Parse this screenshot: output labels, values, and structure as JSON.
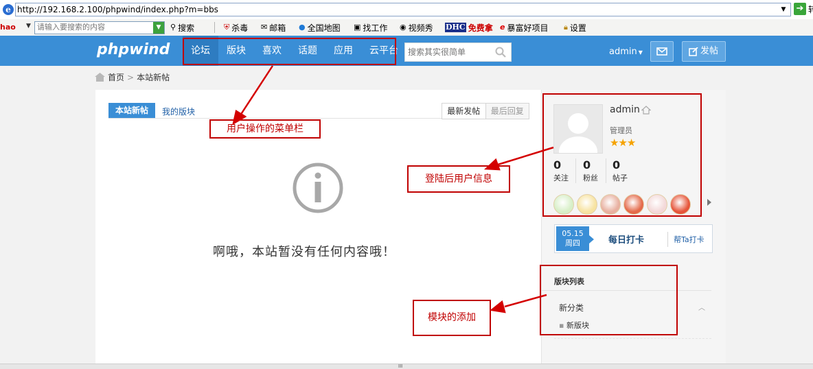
{
  "browser": {
    "url": "http://192.168.2.100/phpwind/index.php?m=bbs",
    "go_label": "转"
  },
  "toolbar": {
    "logo": "hao",
    "search_placeholder": "请输入要搜索的内容",
    "items": [
      {
        "label": "搜索",
        "icon": "magnifier-icon"
      },
      {
        "label": "杀毒",
        "icon": "shield-icon"
      },
      {
        "label": "邮箱",
        "icon": "mail-icon"
      },
      {
        "label": "全国地图",
        "icon": "globe-icon"
      },
      {
        "label": "找工作",
        "icon": "job-icon"
      },
      {
        "label": "视频秀",
        "icon": "video-icon"
      },
      {
        "label": "免费拿",
        "icon": "dhc-icon",
        "prefix": "DHC"
      },
      {
        "label": "暴富好项目",
        "icon": "e-icon"
      },
      {
        "label": "设置",
        "icon": "lock-icon"
      }
    ]
  },
  "header": {
    "brand": "phpwind",
    "nav": [
      "论坛",
      "版块",
      "喜欢",
      "话题",
      "应用",
      "云平台"
    ],
    "search_placeholder": "搜索其实很简单",
    "username": "admin",
    "post_label": "发帖"
  },
  "breadcrumb": {
    "home": "首页",
    "separator": ">",
    "current": "本站新帖"
  },
  "main": {
    "tabs": [
      "本站新帖",
      "我的版块"
    ],
    "sort": [
      "最新发帖",
      "最后回复"
    ],
    "empty_text": "啊哦，本站暂没有任何内容哦！"
  },
  "sidebar": {
    "username": "admin",
    "role": "管理员",
    "stars": "★★★",
    "stats": [
      {
        "num": "0",
        "label": "关注"
      },
      {
        "num": "0",
        "label": "粉丝"
      },
      {
        "num": "0",
        "label": "帖子"
      }
    ],
    "medal_colors": [
      "#d7efc7",
      "#f7e3a1",
      "#e8b0a0",
      "#e46a4a",
      "#f3d8d8",
      "#e6553a"
    ],
    "checkin": {
      "date": "05.15",
      "weekday": "周四",
      "label": "每日打卡",
      "help": "帮Ta打卡"
    },
    "forum_list": {
      "title": "版块列表",
      "category": "新分类",
      "item": "新版块"
    }
  },
  "annotations": {
    "menu": "用户操作的菜单栏",
    "userinfo": "登陆后用户信息",
    "module": "模块的添加"
  },
  "colors": {
    "header_blue": "#3a8ed6",
    "annotation_red": "#c00000"
  }
}
